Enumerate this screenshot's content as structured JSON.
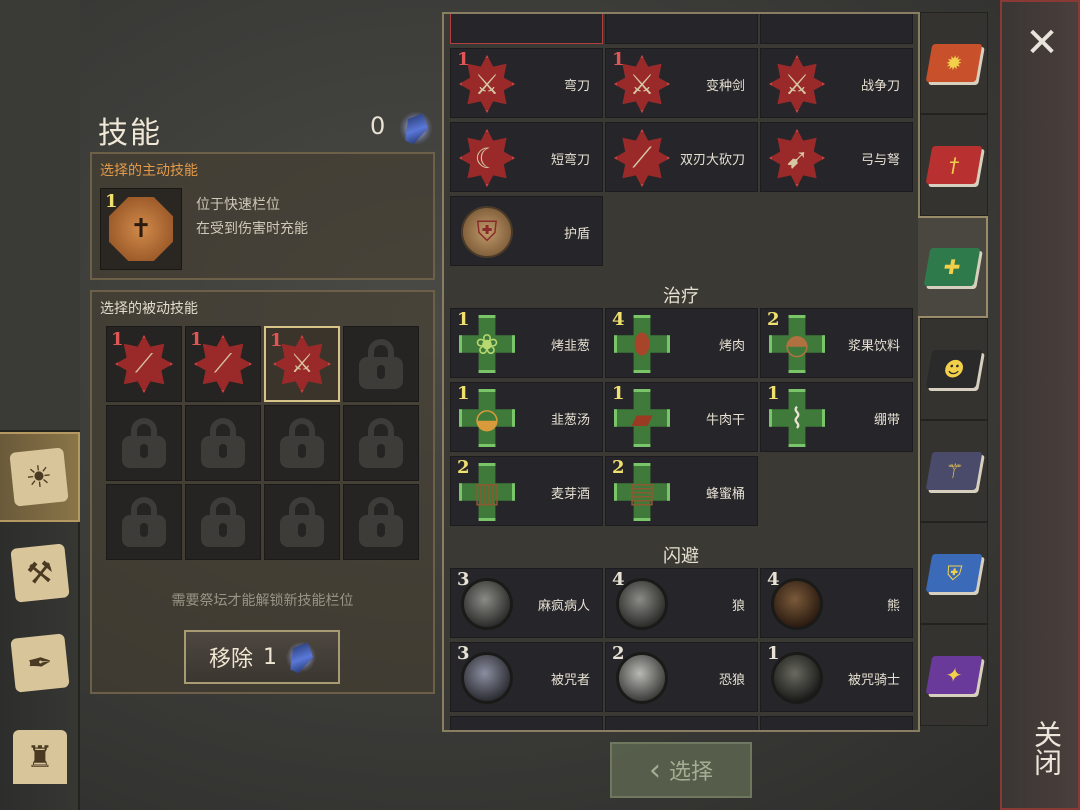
{
  "skills_panel": {
    "title": "技能",
    "currency_count": "0",
    "active_box": {
      "title": "选择的主动技能",
      "level": "1",
      "desc_lines": [
        "位于快速栏位",
        "在受到伤害时充能"
      ]
    },
    "passive_box": {
      "title": "选择的被动技能",
      "slots": [
        {
          "level": "1",
          "icon": "club-icon",
          "locked": false,
          "selected": false
        },
        {
          "level": "1",
          "icon": "club-icon",
          "locked": false,
          "selected": false
        },
        {
          "level": "1",
          "icon": "sword-icon",
          "locked": false,
          "selected": true
        },
        {
          "locked": true
        },
        {
          "locked": true
        },
        {
          "locked": true
        },
        {
          "locked": true
        },
        {
          "locked": true
        },
        {
          "locked": true
        },
        {
          "locked": true
        },
        {
          "locked": true
        },
        {
          "locked": true
        }
      ],
      "hint": "需要祭坛才能解锁新技能栏位"
    },
    "remove_button": {
      "label": "移除",
      "count": "1"
    }
  },
  "skill_list": {
    "weapons": [
      {
        "name": "弯刀",
        "level": "1",
        "icon": "scimitar-icon"
      },
      {
        "name": "变种剑",
        "level": "1",
        "icon": "sword-icon"
      },
      {
        "name": "战争刀",
        "level": "",
        "icon": "war-blade-icon"
      },
      {
        "name": "短弯刀",
        "level": "",
        "icon": "short-scimitar-icon"
      },
      {
        "name": "双刃大砍刀",
        "level": "",
        "icon": "greatsword-icon"
      },
      {
        "name": "弓与弩",
        "level": "",
        "icon": "bow-icon"
      },
      {
        "name": "护盾",
        "level": "",
        "icon": "shield-icon"
      }
    ],
    "healing_title": "治疗",
    "healing": [
      {
        "name": "烤韭葱",
        "level": "1",
        "icon": "roasted-leek-icon"
      },
      {
        "name": "烤肉",
        "level": "4",
        "icon": "steak-icon"
      },
      {
        "name": "浆果饮料",
        "level": "2",
        "icon": "berry-drink-icon"
      },
      {
        "name": "韭葱汤",
        "level": "1",
        "icon": "soup-icon"
      },
      {
        "name": "牛肉干",
        "level": "1",
        "icon": "jerky-icon"
      },
      {
        "name": "绷带",
        "level": "1",
        "icon": "bandage-icon"
      },
      {
        "name": "麦芽酒",
        "level": "2",
        "icon": "ale-icon"
      },
      {
        "name": "蜂蜜桶",
        "level": "2",
        "icon": "honey-barrel-icon"
      }
    ],
    "dodge_title": "闪避",
    "dodge": [
      {
        "name": "麻疯病人",
        "level": "3",
        "icon": "leper-icon"
      },
      {
        "name": "狼",
        "level": "4",
        "icon": "wolf-icon"
      },
      {
        "name": "熊",
        "level": "4",
        "icon": "bear-icon"
      },
      {
        "name": "被咒者",
        "level": "3",
        "icon": "cursed-icon"
      },
      {
        "name": "恐狼",
        "level": "2",
        "icon": "dire-wolf-icon"
      },
      {
        "name": "被咒骑士",
        "level": "1",
        "icon": "cursed-knight-icon"
      }
    ]
  },
  "category_tabs": [
    {
      "icon": "sun-book-icon",
      "color": "#c8502a"
    },
    {
      "icon": "sword-book-icon",
      "color": "#b83030"
    },
    {
      "icon": "cross-book-icon",
      "color": "#2f7a4a",
      "active": true
    },
    {
      "icon": "mask-book-icon",
      "color": "#2a2a2a"
    },
    {
      "icon": "dagger-book-icon",
      "color": "#4a4a6a"
    },
    {
      "icon": "shield-book-icon",
      "color": "#3a6ab8"
    },
    {
      "icon": "burst-book-icon",
      "color": "#6a3a9a"
    }
  ],
  "select_button": {
    "label": "选择"
  },
  "close": {
    "label": "关闭"
  }
}
